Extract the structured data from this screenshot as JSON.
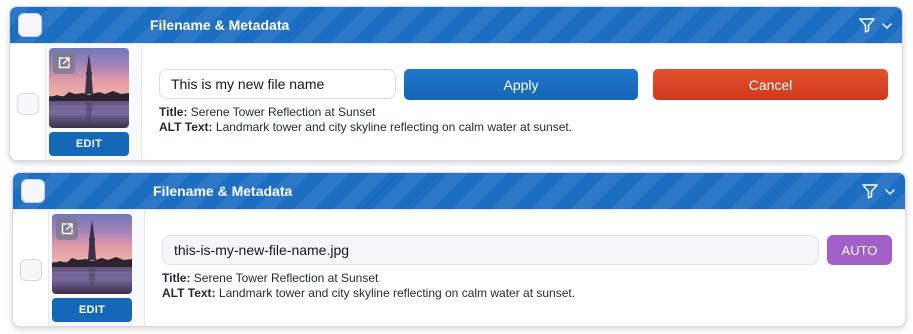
{
  "colors": {
    "header_blue": "#1c6ec2",
    "apply_blue": "#1a6fc0",
    "cancel_red": "#d84426",
    "auto_purple": "#a25fc9",
    "edit_blue": "#1568b8"
  },
  "icons": {
    "filter": "funnel-icon",
    "expand": "chevron-down-icon",
    "open_image": "external-link-icon"
  },
  "panels": [
    {
      "header": {
        "title": "Filename & Metadata"
      },
      "thumbnail": {
        "edit_label": "EDIT",
        "alt": "Tower at sunset"
      },
      "filename": {
        "value": "This is my new file name",
        "editable": true
      },
      "actions": {
        "apply_label": "Apply",
        "cancel_label": "Cancel"
      },
      "meta": {
        "title_label": "Title:",
        "title_value": "Serene Tower Reflection at Sunset",
        "alt_label": "ALT Text:",
        "alt_value": "Landmark tower and city skyline reflecting on calm water at sunset."
      }
    },
    {
      "header": {
        "title": "Filename & Metadata"
      },
      "thumbnail": {
        "edit_label": "EDIT",
        "alt": "Tower at sunset"
      },
      "filename": {
        "value": "this-is-my-new-file-name.jpg",
        "editable": false
      },
      "actions": {
        "auto_label": "AUTO"
      },
      "meta": {
        "title_label": "Title:",
        "title_value": "Serene Tower Reflection at Sunset",
        "alt_label": "ALT Text:",
        "alt_value": "Landmark tower and city skyline reflecting on calm water at sunset."
      }
    }
  ]
}
